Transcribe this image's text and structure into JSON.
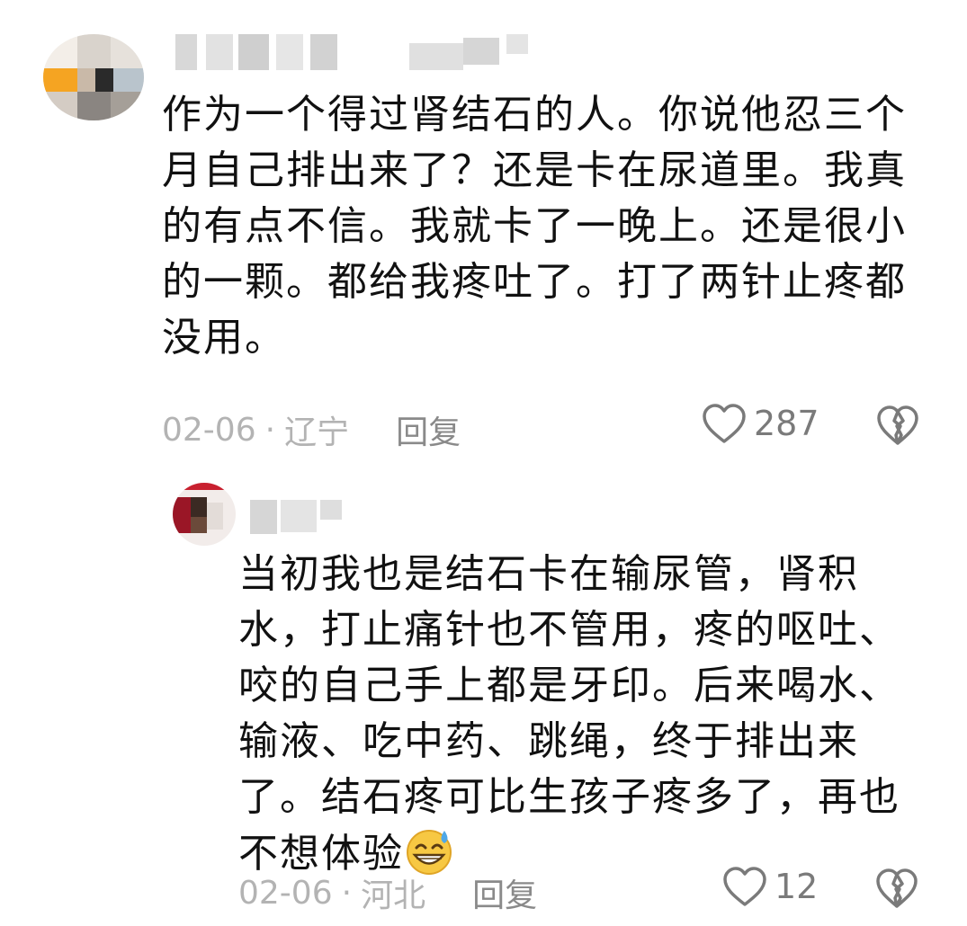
{
  "comments": [
    {
      "text": "作为一个得过肾结石的人。你说他忍三个月自己排出来了？还是卡在尿道里。我真的有点不信。我就卡了一晚上。还是很小的一颗。都给我疼吐了。打了两针止疼都没用。",
      "date": "02-06",
      "separator": "·",
      "location": "辽宁",
      "reply_label": "回复",
      "likes": "287",
      "like_icon": "heart-outline-icon",
      "dislike_icon": "broken-heart-icon"
    }
  ],
  "replies": [
    {
      "text": "当初我也是结石卡在输尿管，肾积水，打止痛针也不管用，疼的呕吐、咬的自己手上都是牙印。后来喝水、输液、吃中药、跳绳，终于排出来了。结石疼可比生孩子疼多了，再也不想体验",
      "emoji": "grinning-sweat-emoji",
      "date": "02-06",
      "separator": "·",
      "location": "河北",
      "reply_label": "回复",
      "likes": "12",
      "like_icon": "heart-outline-icon",
      "dislike_icon": "broken-heart-icon"
    }
  ],
  "colors": {
    "text": "#111111",
    "meta": "#b3b3b3",
    "icon": "#7a7a7a"
  }
}
